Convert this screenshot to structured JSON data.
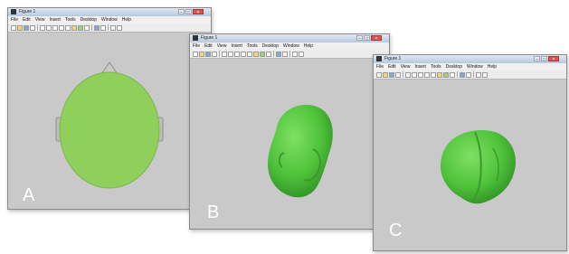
{
  "windows": [
    {
      "title": "Figure 1",
      "menu": [
        "File",
        "Edit",
        "View",
        "Insert",
        "Tools",
        "Desktop",
        "Window",
        "Help"
      ],
      "panel_label": "A",
      "view": "top-down head model"
    },
    {
      "title": "Figure 1",
      "menu": [
        "File",
        "Edit",
        "View",
        "Insert",
        "Tools",
        "Desktop",
        "Window",
        "Help"
      ],
      "panel_label": "B",
      "view": "3d head surface"
    },
    {
      "title": "Figure 1",
      "menu": [
        "File",
        "Edit",
        "View",
        "Insert",
        "Tools",
        "Desktop",
        "Window",
        "Help"
      ],
      "panel_label": "C",
      "view": "3d brain surface"
    }
  ],
  "colors": {
    "surface": "#8fcf5b",
    "surface_3d": "#5cc447",
    "background": "#c9c9c9"
  },
  "icons": [
    "new-file-icon",
    "open-folder-icon",
    "save-icon",
    "print-icon",
    "pointer-icon",
    "zoom-in-icon",
    "zoom-out-icon",
    "pan-icon",
    "rotate-icon",
    "data-cursor-icon",
    "brush-icon",
    "link-icon",
    "colorbar-icon",
    "legend-icon",
    "hide-plot-tools-icon",
    "show-plot-tools-icon"
  ]
}
